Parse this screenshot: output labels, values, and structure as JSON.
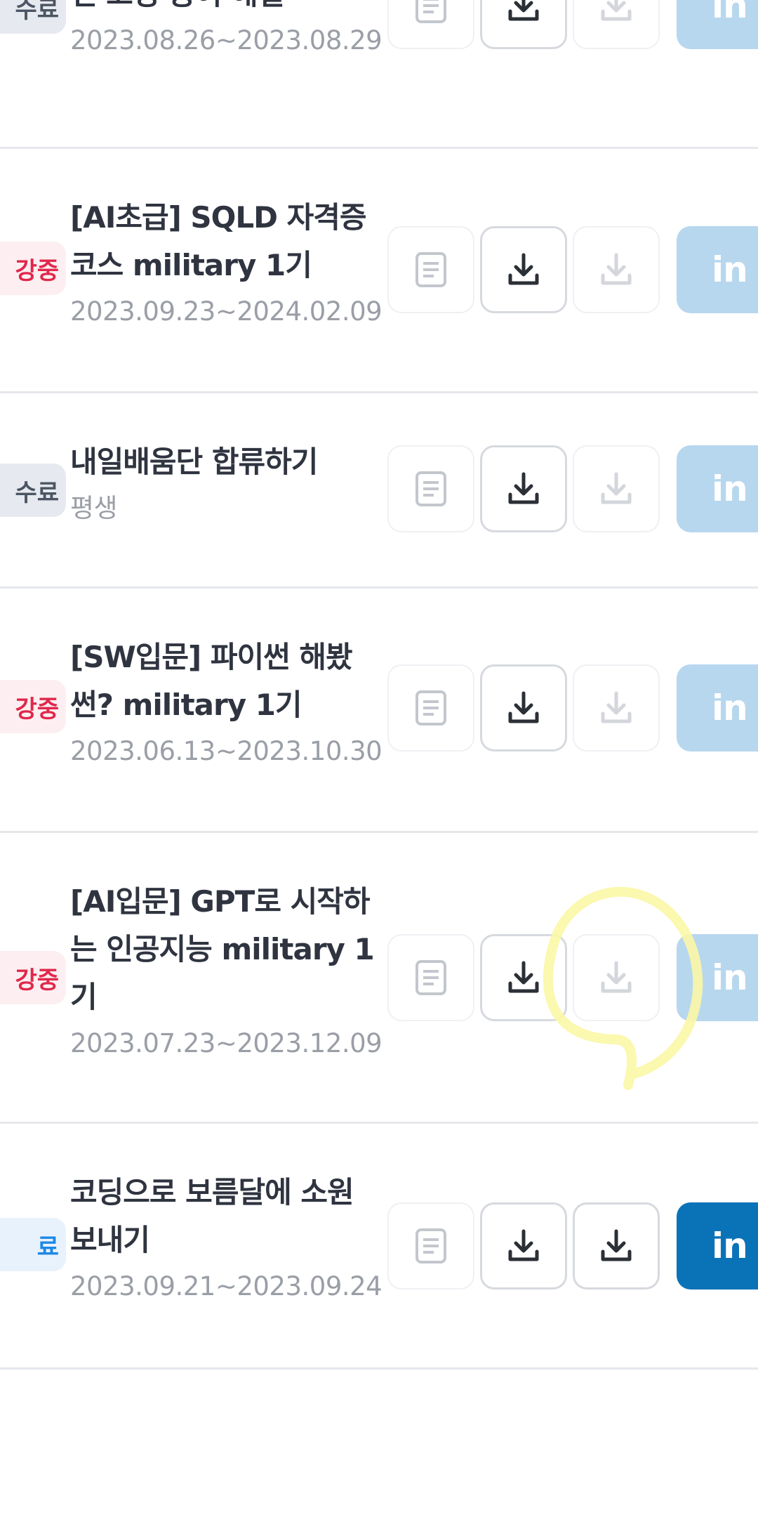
{
  "linkedin_label": "in",
  "colors": {
    "linkedin_enabled": "#0a73b8",
    "linkedin_disabled": "#b7d7ee",
    "badge_active": "#e0284b",
    "badge_done": "#4b5563",
    "highlight": "#fbf7a6"
  },
  "icons": {
    "document": "document-icon",
    "download": "download-icon"
  },
  "courses": [
    {
      "badge": "수료",
      "badge_type": "done",
      "title_lines": [
        "인 코딩 용어 해설 -"
      ],
      "date": "2023.08.26~2023.08.29",
      "cert_download_enabled": false,
      "linkedin_enabled": false
    },
    {
      "badge": "강중",
      "badge_type": "active",
      "title_lines": [
        "[AI초급] SQLD 자격증",
        "코스 military 1기"
      ],
      "date": "2023.09.23~2024.02.09",
      "cert_download_enabled": false,
      "linkedin_enabled": false
    },
    {
      "badge": "수료",
      "badge_type": "done",
      "title_lines": [
        "내일배움단 합류하기"
      ],
      "date": "평생",
      "cert_download_enabled": false,
      "linkedin_enabled": false
    },
    {
      "badge": "강중",
      "badge_type": "active",
      "title_lines": [
        "[SW입문] 파이썬 해봤",
        "썬? military 1기"
      ],
      "date": "2023.06.13~2023.10.30",
      "cert_download_enabled": false,
      "linkedin_enabled": false
    },
    {
      "badge": "강중",
      "badge_type": "active",
      "title_lines": [
        "[AI입문] GPT로 시작하",
        "는 인공지능 military 1",
        "기"
      ],
      "date": "2023.07.23~2023.12.09",
      "cert_download_enabled": false,
      "linkedin_enabled": false
    },
    {
      "badge": "료",
      "badge_type": "blue",
      "title_lines": [
        "코딩으로 보름달에 소원",
        "보내기"
      ],
      "date": "2023.09.21~2023.09.24",
      "cert_download_enabled": true,
      "linkedin_enabled": true
    }
  ]
}
